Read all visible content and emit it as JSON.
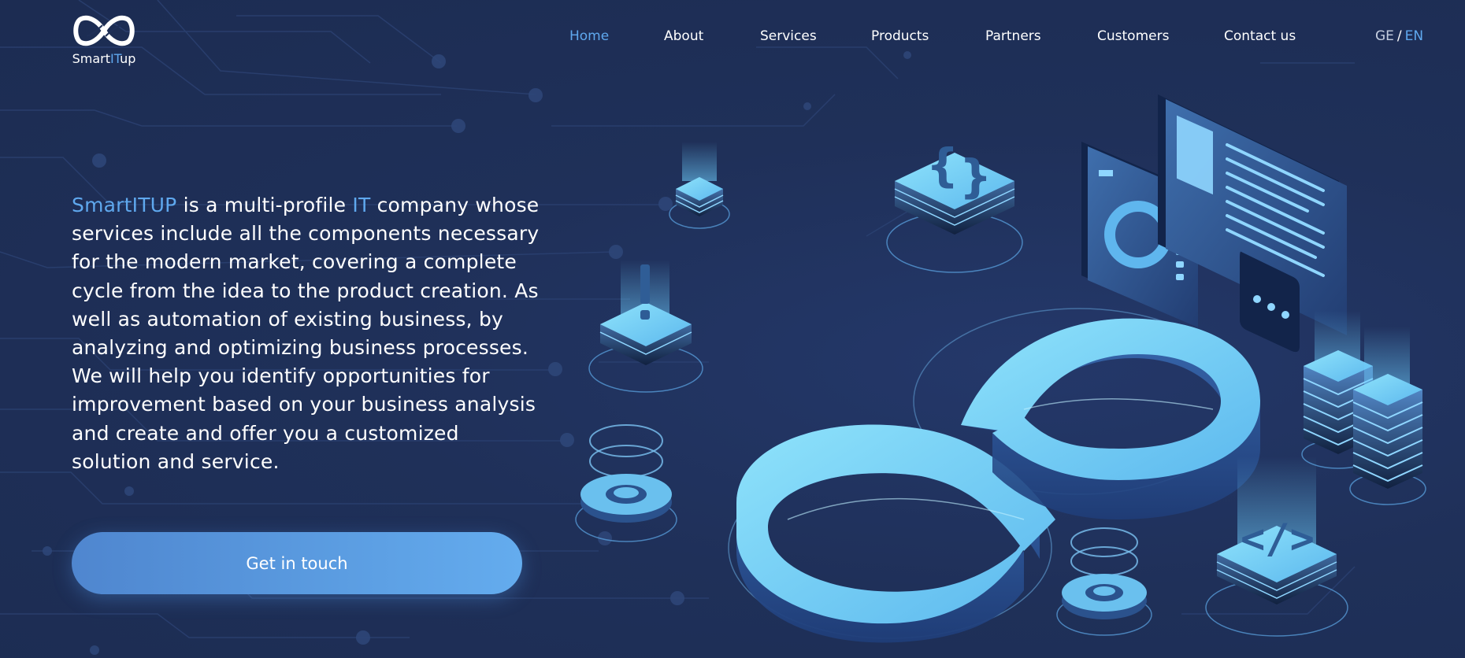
{
  "header": {
    "logo": {
      "text_prefix": "Smart",
      "text_highlight": "IT",
      "text_suffix": "up",
      "icon": "infinity-icon"
    },
    "nav": [
      {
        "label": "Home",
        "active": true
      },
      {
        "label": "About",
        "active": false
      },
      {
        "label": "Services",
        "active": false
      },
      {
        "label": "Products",
        "active": false
      },
      {
        "label": "Partners",
        "active": false
      },
      {
        "label": "Customers",
        "active": false
      },
      {
        "label": "Contact us",
        "active": false
      }
    ],
    "language": {
      "ge": "GE",
      "separator": "/",
      "en": "EN",
      "selected": "EN"
    }
  },
  "hero": {
    "brand": "SmartITUP",
    "text_1": " is a multi-profile ",
    "it": "IT",
    "text_2": " company whose services include all the components necessary for the modern market, covering a complete cycle from the idea to the product creation. As well as automation of existing business, by analyzing and optimizing business processes. We will help you identify opportunities for improvement based on your business analysis and create and offer you a customized solution and service.",
    "cta_label": "Get in touch"
  },
  "illustration": {
    "icons": [
      "infinity-3d-icon",
      "database-icon",
      "code-braces-icon",
      "chart-screen-icon",
      "document-screen-icon",
      "chat-bubble-icon",
      "server-stack-icon",
      "gear-icon",
      "code-tag-icon",
      "exclamation-icon"
    ]
  },
  "colors": {
    "background": "#1e2f57",
    "accent": "#5fa8ee",
    "text": "#ffffff",
    "button_gradient_start": "#4f86cf",
    "button_gradient_end": "#64acee"
  }
}
